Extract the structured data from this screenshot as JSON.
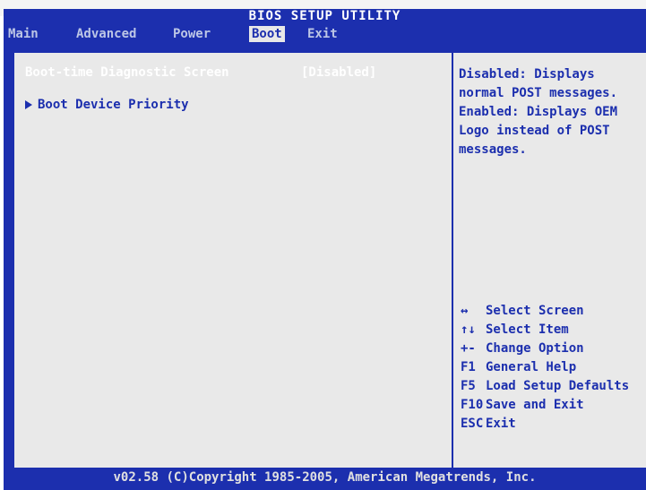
{
  "title": "BIOS SETUP UTILITY",
  "menu": [
    {
      "label": "Main"
    },
    {
      "label": "Advanced"
    },
    {
      "label": "Power"
    },
    {
      "label": "Boot"
    },
    {
      "label": "Exit"
    }
  ],
  "active_menu": "Boot",
  "settings": {
    "boot_diag_label": "Boot-time Diagnostic Screen",
    "boot_diag_value": "[Disabled]",
    "boot_device_priority": "Boot Device Priority"
  },
  "help_text": "Disabled: Displays\nnormal POST messages.\nEnabled: Displays OEM\nLogo instead of POST\nmessages.",
  "keys": [
    {
      "key": "↔",
      "action": "Select Screen"
    },
    {
      "key": "↑↓",
      "action": "Select Item"
    },
    {
      "key": "+-",
      "action": "Change Option"
    },
    {
      "key": "F1",
      "action": "General Help"
    },
    {
      "key": "F5",
      "action": "Load Setup Defaults"
    },
    {
      "key": "F10",
      "action": "Save and Exit"
    },
    {
      "key": "ESC",
      "action": "Exit"
    }
  ],
  "footer": "v02.58 (C)Copyright 1985-2005, American Megatrends, Inc.",
  "colors": {
    "background_blue": "#1c2fae",
    "panel_gray": "#e9e9e9",
    "highlight_text": "#ffffff"
  }
}
